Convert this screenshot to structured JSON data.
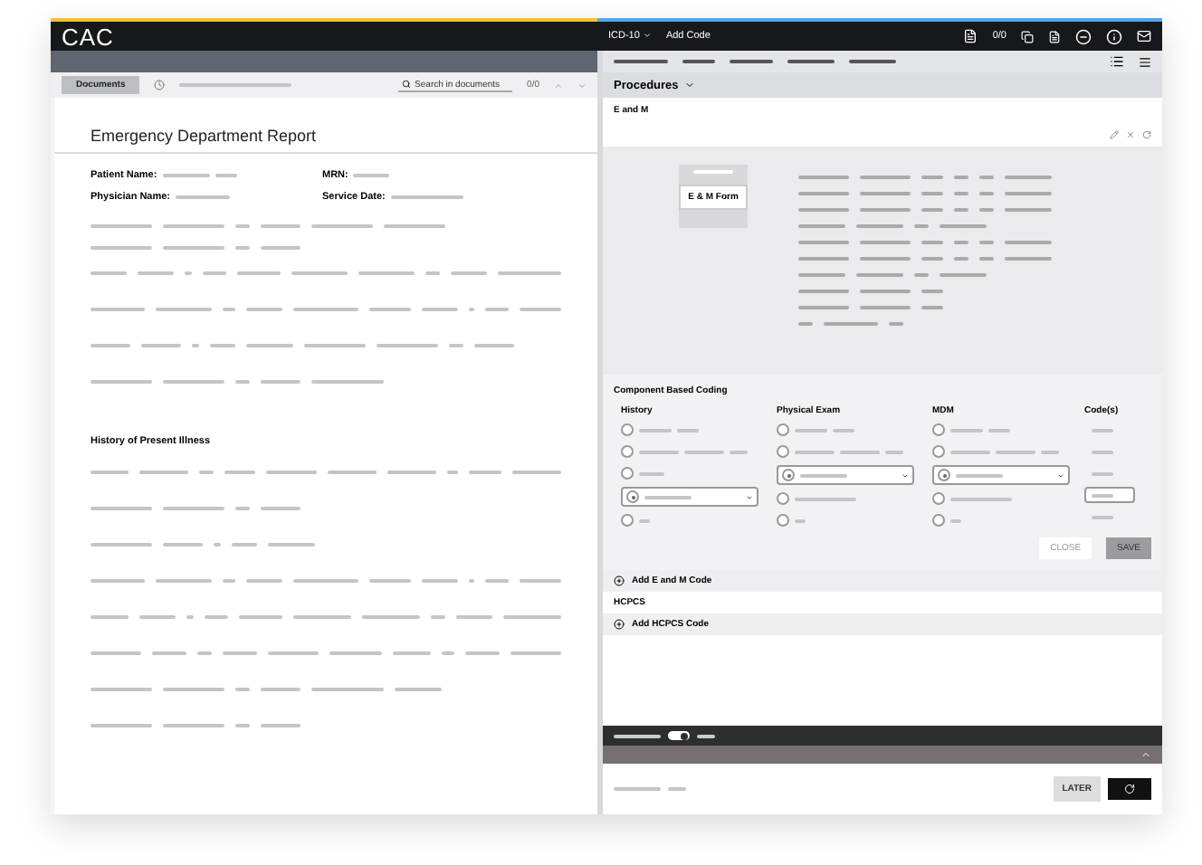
{
  "app": {
    "title": "CAC"
  },
  "toolbar": {
    "code_set": "ICD-10",
    "add_code": "Add Code",
    "counter": "0/0"
  },
  "documents": {
    "tab": {
      "label": "Documents",
      "selected": true
    },
    "search": {
      "placeholder": "Search in documents"
    },
    "count": "0/0"
  },
  "document": {
    "title": "Emergency Department Report",
    "fields": [
      {
        "label": "Patient Name:"
      },
      {
        "label": "MRN:"
      },
      {
        "label": "Physician Name:"
      },
      {
        "label": "Service Date:"
      }
    ],
    "section": "History of Present Illness"
  },
  "procedures": {
    "heading": "Procedures",
    "group": "E and M",
    "form_button": "E & M Form"
  },
  "coding": {
    "title": "Component Based Coding",
    "columns": [
      {
        "heading": "History",
        "options": [
          {
            "kind": "radio",
            "selected": false
          },
          {
            "kind": "radio",
            "selected": false
          },
          {
            "kind": "radio",
            "selected": false
          },
          {
            "kind": "select",
            "selected": true
          },
          {
            "kind": "radio",
            "selected": false
          }
        ]
      },
      {
        "heading": "Physical Exam",
        "options": [
          {
            "kind": "radio",
            "selected": false
          },
          {
            "kind": "radio",
            "selected": false
          },
          {
            "kind": "select",
            "selected": true
          },
          {
            "kind": "radio",
            "selected": false
          },
          {
            "kind": "radio",
            "selected": false
          }
        ]
      },
      {
        "heading": "MDM",
        "options": [
          {
            "kind": "radio",
            "selected": false
          },
          {
            "kind": "radio",
            "selected": false
          },
          {
            "kind": "select",
            "selected": true
          },
          {
            "kind": "radio",
            "selected": false
          },
          {
            "kind": "radio",
            "selected": false
          }
        ]
      }
    ],
    "codes_heading": "Code(s)",
    "codes": [
      {
        "selected": false
      },
      {
        "selected": false
      },
      {
        "selected": false
      },
      {
        "selected": true
      },
      {
        "selected": false
      }
    ],
    "close": "CLOSE",
    "save": "SAVE"
  },
  "add_em": "Add E and M Code",
  "hcpcs": "HCPCS",
  "add_hcpcs": "Add HCPCS Code",
  "bottom": {
    "toggle": {
      "on": true
    },
    "later": "LATER"
  }
}
